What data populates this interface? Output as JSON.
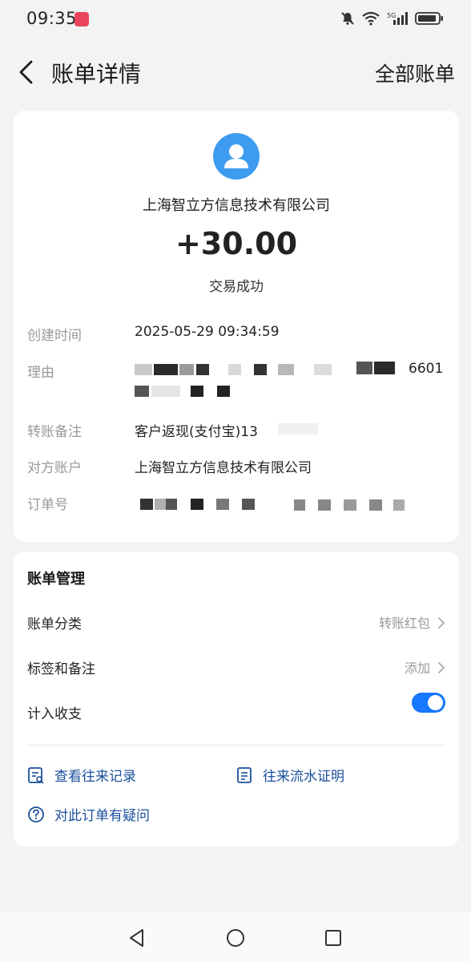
{
  "status_bar": {
    "time": "09:35",
    "network": "5G",
    "icons": [
      "app-notification-icon",
      "mute-bell-icon",
      "wifi-icon",
      "5g-signal-icon",
      "battery-icon"
    ]
  },
  "nav": {
    "title": "账单详情",
    "right_link": "全部账单"
  },
  "transaction": {
    "merchant": "上海智立方信息技术有限公司",
    "amount": "+30.00",
    "status": "交易成功"
  },
  "details": {
    "created_label": "创建时间",
    "created_value": "2025-05-29 09:34:59",
    "reason_label": "理由",
    "reason_value_visible": "6601",
    "remark_label": "转账备注",
    "remark_value": "客户返现(支付宝)13",
    "account_label": "对方账户",
    "account_value": "上海智立方信息技术有限公司",
    "order_label": "订单号"
  },
  "management": {
    "title": "账单管理",
    "category_label": "账单分类",
    "category_value": "转账红包",
    "tags_label": "标签和备注",
    "tags_value": "添加",
    "income_label": "计入收支",
    "income_enabled": true,
    "toggle_color": "#1677ff"
  },
  "links": {
    "records": "查看往来记录",
    "proof": "往来流水证明",
    "question": "对此订单有疑问",
    "link_color": "#1a4f9c"
  },
  "system_nav": {
    "icons": [
      "back-triangle-icon",
      "home-circle-icon",
      "recents-square-icon"
    ]
  }
}
